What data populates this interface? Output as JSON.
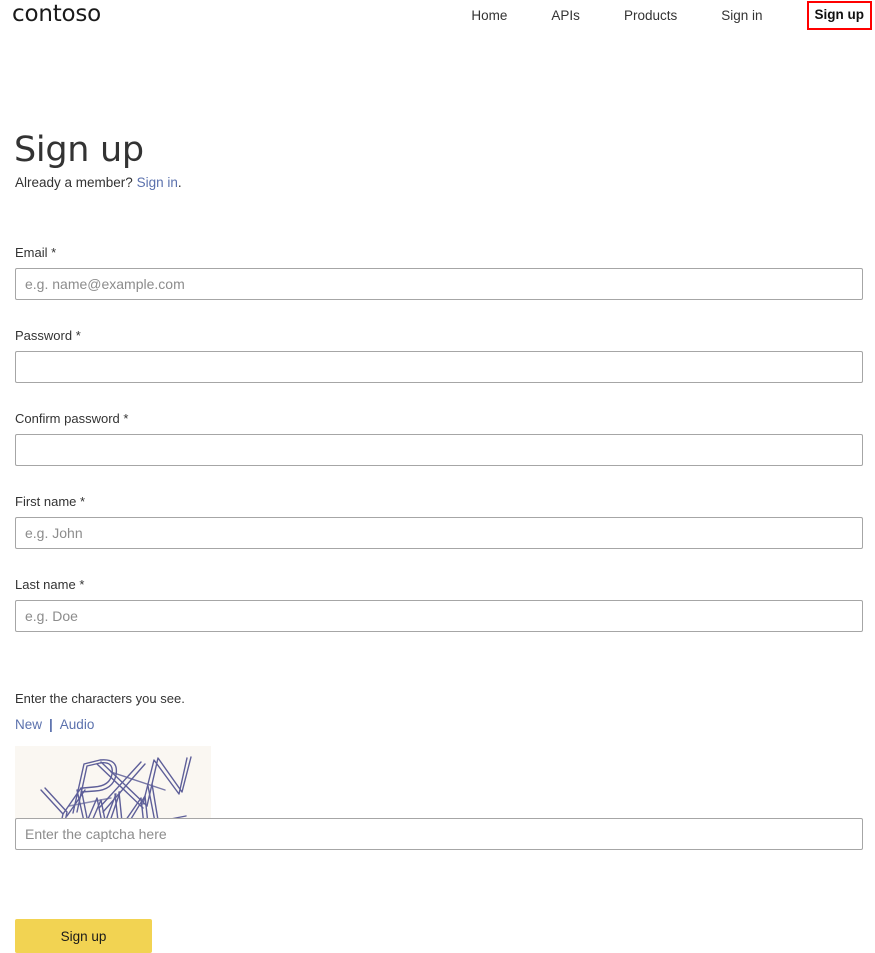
{
  "brand": {
    "logo_text": "contoso"
  },
  "nav": {
    "items": [
      {
        "label": "Home",
        "name": "nav-item-home"
      },
      {
        "label": "APIs",
        "name": "nav-item-apis"
      },
      {
        "label": "Products",
        "name": "nav-item-products"
      },
      {
        "label": "Sign in",
        "name": "nav-item-sign-in"
      },
      {
        "label": "Sign up",
        "name": "nav-item-sign-up"
      }
    ],
    "highlighted_item": "Sign up",
    "highlight_color": "#ff0000"
  },
  "page": {
    "title": "Sign up",
    "member_prompt_prefix": "Already a member? ",
    "member_prompt_link": "Sign in",
    "member_prompt_suffix": "."
  },
  "form": {
    "fields": [
      {
        "label": "Email *",
        "placeholder": "e.g. name@example.com",
        "value": "",
        "type": "email",
        "name": "email-field"
      },
      {
        "label": "Password *",
        "placeholder": "",
        "value": "",
        "type": "password",
        "name": "password-field"
      },
      {
        "label": "Confirm password *",
        "placeholder": "",
        "value": "",
        "type": "password",
        "name": "confirm-password-field"
      },
      {
        "label": "First name *",
        "placeholder": "e.g. John",
        "value": "",
        "type": "text",
        "name": "first-name-field"
      },
      {
        "label": "Last name *",
        "placeholder": "e.g. Doe",
        "value": "",
        "type": "text",
        "name": "last-name-field"
      }
    ]
  },
  "captcha": {
    "instructions": "Enter the characters you see.",
    "new_link": "New",
    "separator": "|",
    "audio_link": "Audio",
    "characters": "PXNYWNL",
    "image_background": "#faf7f2",
    "stroke_color": "#5e5f99",
    "input_placeholder": "Enter the captcha here",
    "input_value": ""
  },
  "submit": {
    "label": "Sign up",
    "color": "#f2d352"
  },
  "links": {
    "color": "#5b71ad"
  }
}
